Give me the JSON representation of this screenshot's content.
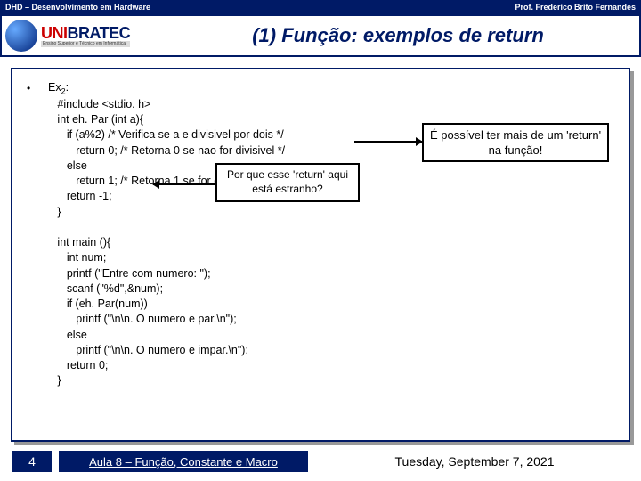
{
  "topbar": {
    "left": "DHD – Desenvolvimento em Hardware",
    "right": "Prof. Frederico Brito Fernandes"
  },
  "logo": {
    "uni": "UNI",
    "bratec": "BRATEC",
    "sub": "Ensino Superior e Técnico em Informática"
  },
  "title": "(1) Função: exemplos de return",
  "bullet": "•",
  "code": {
    "l1a": "Ex",
    "l1b": "2",
    "l1c": ":",
    "l2": "   #include <stdio. h>",
    "l3": "   int eh. Par (int a){",
    "l4": "      if (a%2) /* Verifica se a e divisivel por dois */",
    "l5": "         return 0; /* Retorna 0 se nao for divisivel */",
    "l6": "      else",
    "l7": "         return 1; /* Retorna 1 se for divisivel */",
    "l8": "      return -1;",
    "l9": "   }",
    "l10": "",
    "l11": "   int main (){",
    "l12": "      int num;",
    "l13": "      printf (\"Entre com numero: \");",
    "l14": "      scanf (\"%d\",&num);",
    "l15": "      if (eh. Par(num))",
    "l16": "         printf (\"\\n\\n. O numero e par.\\n\");",
    "l17": "      else",
    "l18": "         printf (\"\\n\\n. O numero e impar.\\n\");",
    "l19": "      return 0;",
    "l20": "   }"
  },
  "callout1": "Por que esse 'return' aqui está estranho?",
  "callout2": "É possível ter mais de um 'return' na função!",
  "footer": {
    "page": "4",
    "lesson": "Aula 8 – Função, Constante e Macro",
    "date": "Tuesday, September 7, 2021"
  }
}
